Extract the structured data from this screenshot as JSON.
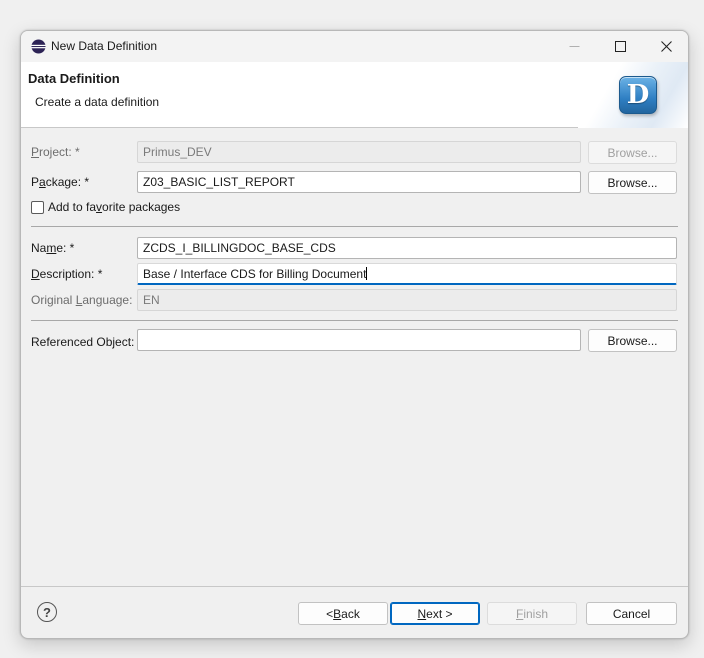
{
  "window": {
    "title": "New Data Definition",
    "icon": "eclipse-icon"
  },
  "header": {
    "title": "Data Definition",
    "subtitle": "Create a data definition",
    "badge_letter": "D"
  },
  "form": {
    "project": {
      "label": "Project: *",
      "value": "Primus_DEV",
      "browse": "Browse...",
      "enabled": false
    },
    "package": {
      "label": "Package: *",
      "value": "Z03_BASIC_LIST_REPORT",
      "browse": "Browse..."
    },
    "favorite": {
      "label": "Add to favorite packages",
      "checked": false
    },
    "name": {
      "label": "Name: *",
      "value": "ZCDS_I_BILLINGDOC_BASE_CDS"
    },
    "description": {
      "label": "Description: *",
      "value": "Base / Interface CDS for Billing Document"
    },
    "original_language": {
      "label": "Original Language:",
      "value": "EN",
      "enabled": false
    },
    "referenced_object": {
      "label": "Referenced Object:",
      "value": "",
      "browse": "Browse..."
    }
  },
  "footer": {
    "back": "< Back",
    "next": "Next >",
    "finish": "Finish",
    "cancel": "Cancel",
    "help_icon": "question-circle-icon"
  },
  "colors": {
    "accent": "#0067c0",
    "badge": "#2f7fc3"
  }
}
